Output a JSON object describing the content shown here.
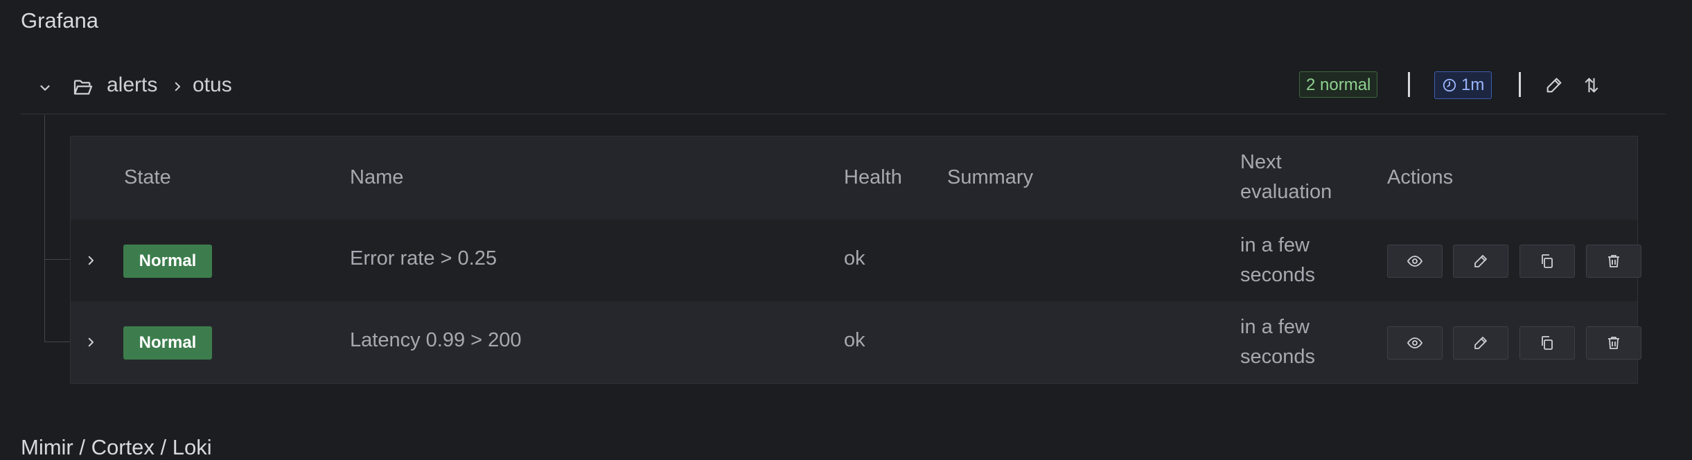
{
  "sections": [
    {
      "title": "Grafana"
    },
    {
      "title": "Mimir / Cortex / Loki"
    }
  ],
  "group": {
    "breadcrumb": [
      "alerts",
      "otus"
    ],
    "normal_badge": "2 normal",
    "interval_badge": "1m"
  },
  "table": {
    "headers": {
      "state": "State",
      "name": "Name",
      "health": "Health",
      "summary": "Summary",
      "next_evaluation": "Next evaluation",
      "actions": "Actions"
    },
    "rows": [
      {
        "state": "Normal",
        "name": "Error rate > 0.25",
        "health": "ok",
        "summary": "",
        "next_evaluation": "in a few seconds"
      },
      {
        "state": "Normal",
        "name": "Latency 0.99 > 200",
        "health": "ok",
        "summary": "",
        "next_evaluation": "in a few seconds"
      }
    ]
  },
  "icons": {
    "collapse": "chevron-down-icon",
    "folder": "folder-open-icon",
    "breadcrumb_separator": "chevron-right-icon",
    "interval": "clock-icon",
    "edit": "pencil-icon",
    "sort": "sort-arrows-icon",
    "expand": "chevron-right-icon",
    "view": "eye-icon",
    "copy": "copy-icon",
    "delete": "trash-icon"
  },
  "colors": {
    "background": "#1c1d21",
    "state_normal": "#3d7d4d",
    "badge_normal_text": "#8fd18f",
    "badge_interval_text": "#9bb6ff"
  }
}
